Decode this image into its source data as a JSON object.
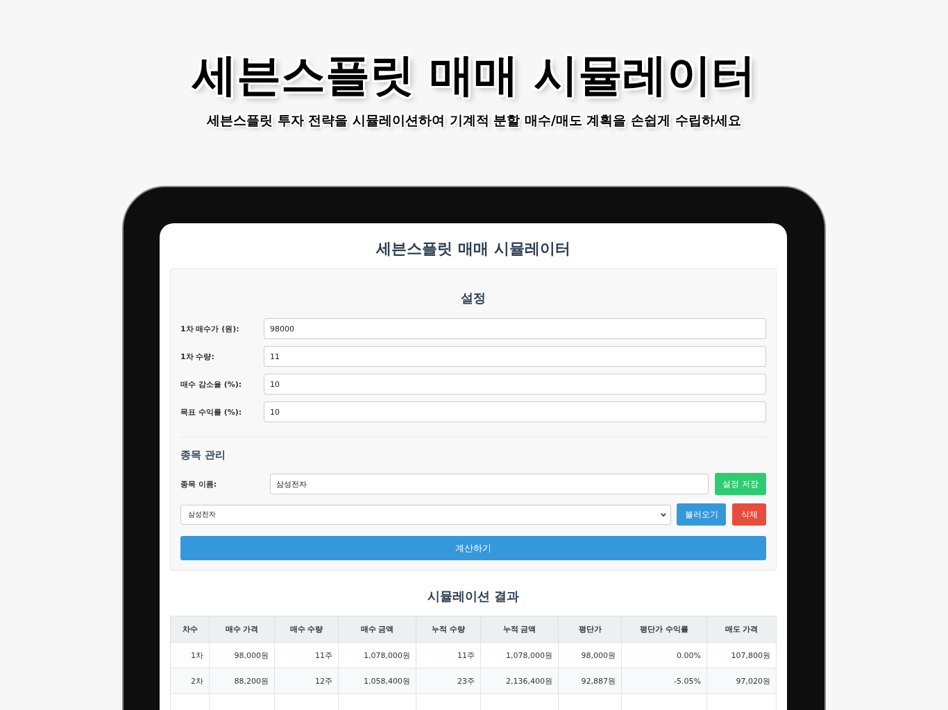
{
  "page": {
    "title": "세븐스플릿 매매 시뮬레이터",
    "subtitle": "세븐스플릿 투자 전략을 시뮬레이션하여 기계적 분할 매수/매도 계획을 손쉽게 수립하세요"
  },
  "app": {
    "title": "세븐스플릿 매매 시뮬레이터"
  },
  "settings": {
    "title": "설정",
    "fields": [
      {
        "label": "1차 매수가 (원):",
        "value": "98000"
      },
      {
        "label": "1차 수량:",
        "value": "11"
      },
      {
        "label": "매수 감소율 (%):",
        "value": "10"
      },
      {
        "label": "목표 수익률 (%):",
        "value": "10"
      }
    ]
  },
  "stock_management": {
    "title": "종목 관리",
    "name_field": {
      "label": "종목 이름:",
      "value": "삼성전자"
    },
    "save_button": "설정 저장",
    "select": {
      "value": "삼성전자"
    },
    "load_button": "불러오기",
    "delete_button": "삭제"
  },
  "calculate_button": "계산하기",
  "results": {
    "title": "시뮬레이션 결과",
    "columns": [
      "차수",
      "매수 가격",
      "매수 수량",
      "매수 금액",
      "누적 수량",
      "누적 금액",
      "평단가",
      "평단가 수익률",
      "매도 가격"
    ],
    "rows": [
      [
        "1차",
        "98,000원",
        "11주",
        "1,078,000원",
        "11주",
        "1,078,000원",
        "98,000원",
        "0.00%",
        "107,800원"
      ],
      [
        "2차",
        "88,200원",
        "12주",
        "1,058,400원",
        "23주",
        "2,136,400원",
        "92,887원",
        "-5.05%",
        "97,020원"
      ]
    ]
  }
}
